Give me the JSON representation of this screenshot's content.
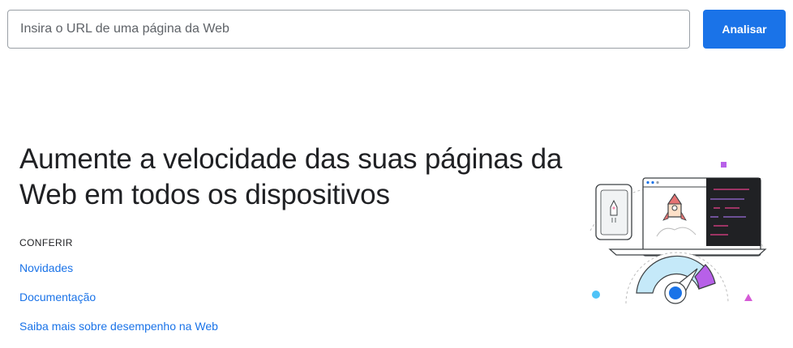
{
  "search": {
    "placeholder": "Insira o URL de uma página da Web",
    "value": "",
    "button_label": "Analisar"
  },
  "hero": {
    "title": "Aumente a velocidade das suas páginas da Web em todos os dispositivos"
  },
  "explore": {
    "label": "CONFERIR",
    "links": [
      {
        "label": "Novidades"
      },
      {
        "label": "Documentação"
      },
      {
        "label": "Saiba mais sobre desempenho na Web"
      }
    ]
  },
  "colors": {
    "accent": "#1a73e8",
    "text": "#202124",
    "gauge_fill": "#c5e9f9",
    "gauge_purple": "#b760e8",
    "code_pink": "#e8418a",
    "code_purple": "#9b6ddb"
  },
  "illustration": {
    "icons": [
      "phone-icon",
      "rocket-icon",
      "browser-window-icon",
      "code-editor-icon",
      "speed-gauge-icon"
    ]
  }
}
